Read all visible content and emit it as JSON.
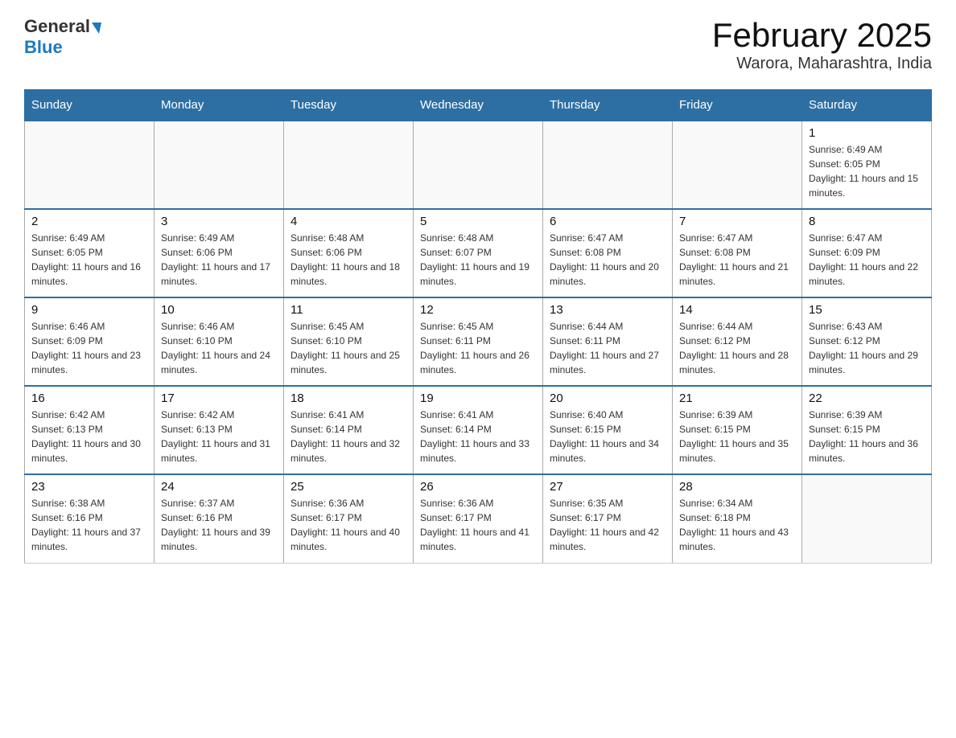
{
  "header": {
    "logo_general": "General",
    "logo_blue": "Blue",
    "month_title": "February 2025",
    "location": "Warora, Maharashtra, India"
  },
  "days_of_week": [
    "Sunday",
    "Monday",
    "Tuesday",
    "Wednesday",
    "Thursday",
    "Friday",
    "Saturday"
  ],
  "weeks": [
    {
      "days": [
        {
          "date": "",
          "info": ""
        },
        {
          "date": "",
          "info": ""
        },
        {
          "date": "",
          "info": ""
        },
        {
          "date": "",
          "info": ""
        },
        {
          "date": "",
          "info": ""
        },
        {
          "date": "",
          "info": ""
        },
        {
          "date": "1",
          "info": "Sunrise: 6:49 AM\nSunset: 6:05 PM\nDaylight: 11 hours and 15 minutes."
        }
      ]
    },
    {
      "days": [
        {
          "date": "2",
          "info": "Sunrise: 6:49 AM\nSunset: 6:05 PM\nDaylight: 11 hours and 16 minutes."
        },
        {
          "date": "3",
          "info": "Sunrise: 6:49 AM\nSunset: 6:06 PM\nDaylight: 11 hours and 17 minutes."
        },
        {
          "date": "4",
          "info": "Sunrise: 6:48 AM\nSunset: 6:06 PM\nDaylight: 11 hours and 18 minutes."
        },
        {
          "date": "5",
          "info": "Sunrise: 6:48 AM\nSunset: 6:07 PM\nDaylight: 11 hours and 19 minutes."
        },
        {
          "date": "6",
          "info": "Sunrise: 6:47 AM\nSunset: 6:08 PM\nDaylight: 11 hours and 20 minutes."
        },
        {
          "date": "7",
          "info": "Sunrise: 6:47 AM\nSunset: 6:08 PM\nDaylight: 11 hours and 21 minutes."
        },
        {
          "date": "8",
          "info": "Sunrise: 6:47 AM\nSunset: 6:09 PM\nDaylight: 11 hours and 22 minutes."
        }
      ]
    },
    {
      "days": [
        {
          "date": "9",
          "info": "Sunrise: 6:46 AM\nSunset: 6:09 PM\nDaylight: 11 hours and 23 minutes."
        },
        {
          "date": "10",
          "info": "Sunrise: 6:46 AM\nSunset: 6:10 PM\nDaylight: 11 hours and 24 minutes."
        },
        {
          "date": "11",
          "info": "Sunrise: 6:45 AM\nSunset: 6:10 PM\nDaylight: 11 hours and 25 minutes."
        },
        {
          "date": "12",
          "info": "Sunrise: 6:45 AM\nSunset: 6:11 PM\nDaylight: 11 hours and 26 minutes."
        },
        {
          "date": "13",
          "info": "Sunrise: 6:44 AM\nSunset: 6:11 PM\nDaylight: 11 hours and 27 minutes."
        },
        {
          "date": "14",
          "info": "Sunrise: 6:44 AM\nSunset: 6:12 PM\nDaylight: 11 hours and 28 minutes."
        },
        {
          "date": "15",
          "info": "Sunrise: 6:43 AM\nSunset: 6:12 PM\nDaylight: 11 hours and 29 minutes."
        }
      ]
    },
    {
      "days": [
        {
          "date": "16",
          "info": "Sunrise: 6:42 AM\nSunset: 6:13 PM\nDaylight: 11 hours and 30 minutes."
        },
        {
          "date": "17",
          "info": "Sunrise: 6:42 AM\nSunset: 6:13 PM\nDaylight: 11 hours and 31 minutes."
        },
        {
          "date": "18",
          "info": "Sunrise: 6:41 AM\nSunset: 6:14 PM\nDaylight: 11 hours and 32 minutes."
        },
        {
          "date": "19",
          "info": "Sunrise: 6:41 AM\nSunset: 6:14 PM\nDaylight: 11 hours and 33 minutes."
        },
        {
          "date": "20",
          "info": "Sunrise: 6:40 AM\nSunset: 6:15 PM\nDaylight: 11 hours and 34 minutes."
        },
        {
          "date": "21",
          "info": "Sunrise: 6:39 AM\nSunset: 6:15 PM\nDaylight: 11 hours and 35 minutes."
        },
        {
          "date": "22",
          "info": "Sunrise: 6:39 AM\nSunset: 6:15 PM\nDaylight: 11 hours and 36 minutes."
        }
      ]
    },
    {
      "days": [
        {
          "date": "23",
          "info": "Sunrise: 6:38 AM\nSunset: 6:16 PM\nDaylight: 11 hours and 37 minutes."
        },
        {
          "date": "24",
          "info": "Sunrise: 6:37 AM\nSunset: 6:16 PM\nDaylight: 11 hours and 39 minutes."
        },
        {
          "date": "25",
          "info": "Sunrise: 6:36 AM\nSunset: 6:17 PM\nDaylight: 11 hours and 40 minutes."
        },
        {
          "date": "26",
          "info": "Sunrise: 6:36 AM\nSunset: 6:17 PM\nDaylight: 11 hours and 41 minutes."
        },
        {
          "date": "27",
          "info": "Sunrise: 6:35 AM\nSunset: 6:17 PM\nDaylight: 11 hours and 42 minutes."
        },
        {
          "date": "28",
          "info": "Sunrise: 6:34 AM\nSunset: 6:18 PM\nDaylight: 11 hours and 43 minutes."
        },
        {
          "date": "",
          "info": ""
        }
      ]
    }
  ]
}
